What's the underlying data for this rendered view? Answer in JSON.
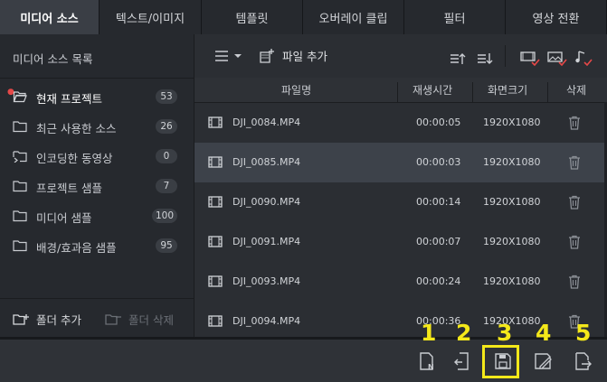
{
  "tabs": [
    {
      "label": "미디어 소스",
      "active": true
    },
    {
      "label": "텍스트/이미지"
    },
    {
      "label": "템플릿"
    },
    {
      "label": "오버레이 클립"
    },
    {
      "label": "필터"
    },
    {
      "label": "영상 전환"
    }
  ],
  "left_panel": {
    "title": "미디어 소스 목록",
    "items": [
      {
        "label": "현재 프로젝트",
        "count": "53",
        "icon": "folder-open-icon"
      },
      {
        "label": "최근 사용한 소스",
        "count": "26",
        "icon": "folder-icon"
      },
      {
        "label": "인코딩한 동영상",
        "count": "0",
        "icon": "folder-encoded-icon"
      },
      {
        "label": "프로젝트 샘플",
        "count": "7",
        "icon": "folder-icon"
      },
      {
        "label": "미디어 샘플",
        "count": "100",
        "icon": "folder-icon"
      },
      {
        "label": "배경/효과음 샘플",
        "count": "95",
        "icon": "folder-icon"
      }
    ],
    "add_folder": "폴더 추가",
    "delete_folder": "폴더 삭제"
  },
  "toolbar": {
    "add_file": "파일 추가"
  },
  "columns": {
    "name": "파일명",
    "duration": "재생시간",
    "resolution": "화면크기",
    "delete": "삭제"
  },
  "files": [
    {
      "name": "DJI_0084.MP4",
      "duration": "00:00:05",
      "resolution": "1920X1080"
    },
    {
      "name": "DJI_0085.MP4",
      "duration": "00:00:03",
      "resolution": "1920X1080",
      "selected": true
    },
    {
      "name": "DJI_0090.MP4",
      "duration": "00:00:14",
      "resolution": "1920X1080"
    },
    {
      "name": "DJI_0091.MP4",
      "duration": "00:00:07",
      "resolution": "1920X1080"
    },
    {
      "name": "DJI_0093.MP4",
      "duration": "00:00:24",
      "resolution": "1920X1080"
    },
    {
      "name": "DJI_0094.MP4",
      "duration": "00:00:36",
      "resolution": "1920X1080"
    }
  ],
  "bottom_numbers": [
    "1",
    "2",
    "3",
    "4",
    "5"
  ],
  "colors": {
    "annotation": "#f4e81a",
    "accent_red": "#e54848"
  }
}
